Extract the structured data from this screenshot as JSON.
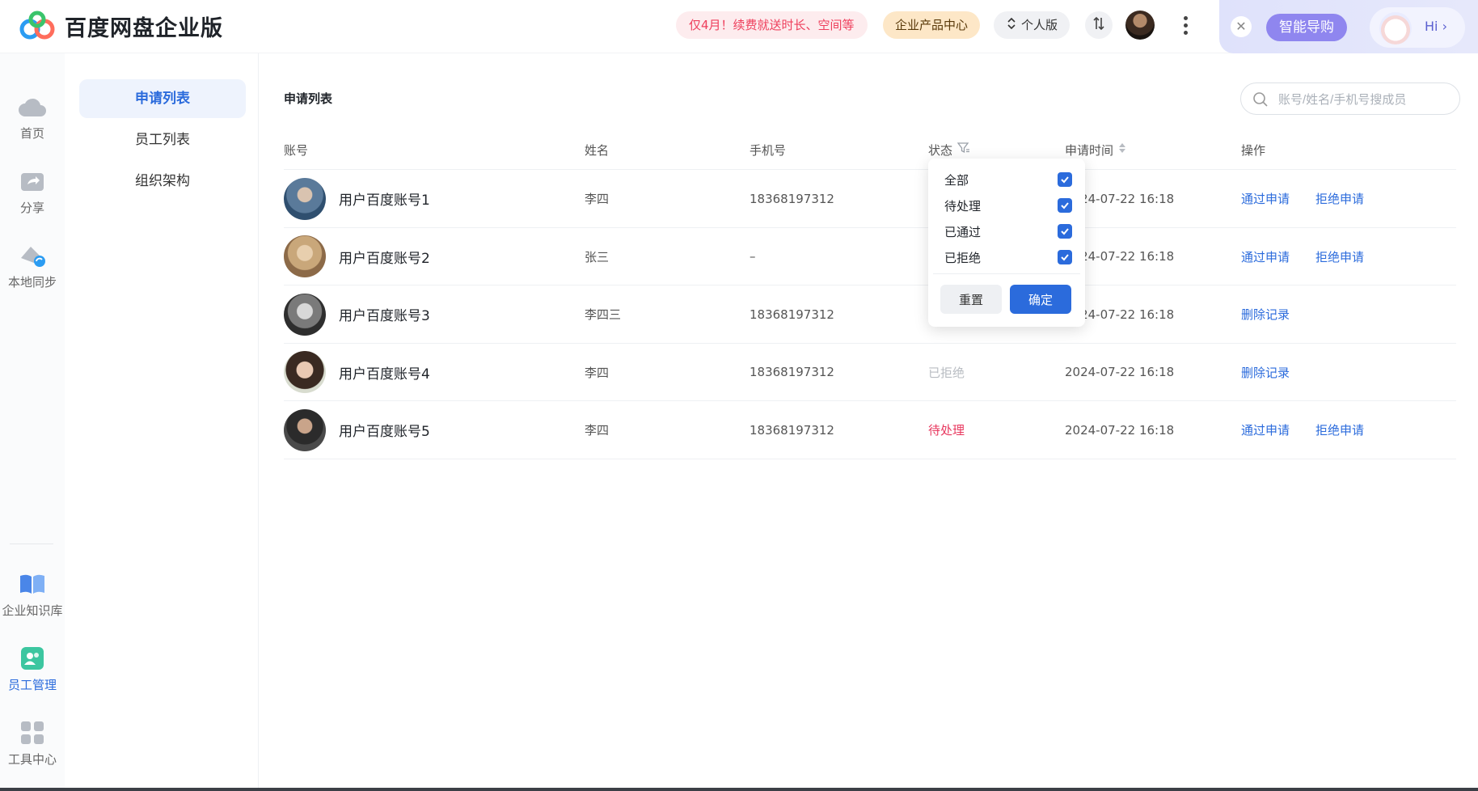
{
  "app": {
    "title": "百度网盘企业版"
  },
  "header": {
    "promo": "仅4月！续费就送时长、空间等",
    "product_center": "企业产品中心",
    "personal": "个人版",
    "assistant_guide": "智能导购",
    "assistant_hi": "Hi ›",
    "assistant_close": "✕"
  },
  "rail": {
    "items": [
      {
        "label": "首页",
        "icon": "cloud-icon"
      },
      {
        "label": "分享",
        "icon": "share-icon"
      },
      {
        "label": "本地同步",
        "icon": "sync-icon"
      },
      {
        "label": "企业知识库",
        "icon": "book-icon"
      },
      {
        "label": "员工管理",
        "icon": "people-icon",
        "active": true
      },
      {
        "label": "工具中心",
        "icon": "grid-icon"
      }
    ]
  },
  "subnav": {
    "items": [
      {
        "label": "申请列表",
        "active": true
      },
      {
        "label": "员工列表"
      },
      {
        "label": "组织架构"
      }
    ]
  },
  "main": {
    "title": "申请列表",
    "search_placeholder": "账号/姓名/手机号搜成员"
  },
  "table": {
    "columns": [
      "账号",
      "姓名",
      "手机号",
      "状态",
      "申请时间",
      "操作"
    ],
    "rows": [
      {
        "account": "用户百度账号1",
        "name": "李四",
        "phone": "18368197312",
        "status": "",
        "time": "2024-07-22 16:18",
        "actions": [
          "通过申请",
          "拒绝申请"
        ]
      },
      {
        "account": "用户百度账号2",
        "name": "张三",
        "phone": "–",
        "status": "",
        "time": "2024-07-22 16:18",
        "actions": [
          "通过申请",
          "拒绝申请"
        ]
      },
      {
        "account": "用户百度账号3",
        "name": "李四三",
        "phone": "18368197312",
        "status": "",
        "time": "2024-07-22 16:18",
        "actions": [
          "删除记录"
        ]
      },
      {
        "account": "用户百度账号4",
        "name": "李四",
        "phone": "18368197312",
        "status": "已拒绝",
        "time": "2024-07-22 16:18",
        "actions": [
          "删除记录"
        ]
      },
      {
        "account": "用户百度账号5",
        "name": "李四",
        "phone": "18368197312",
        "status": "待处理",
        "time": "2024-07-22 16:18",
        "actions": [
          "通过申请",
          "拒绝申请"
        ]
      }
    ]
  },
  "filter": {
    "options": [
      {
        "label": "全部",
        "checked": true
      },
      {
        "label": "待处理",
        "checked": true
      },
      {
        "label": "已通过",
        "checked": true
      },
      {
        "label": "已拒绝",
        "checked": true
      }
    ],
    "reset": "重置",
    "confirm": "确定"
  },
  "colors": {
    "accent": "#2b6bdc",
    "pending": "#e8375e",
    "rejected": "#b8bcc2"
  }
}
